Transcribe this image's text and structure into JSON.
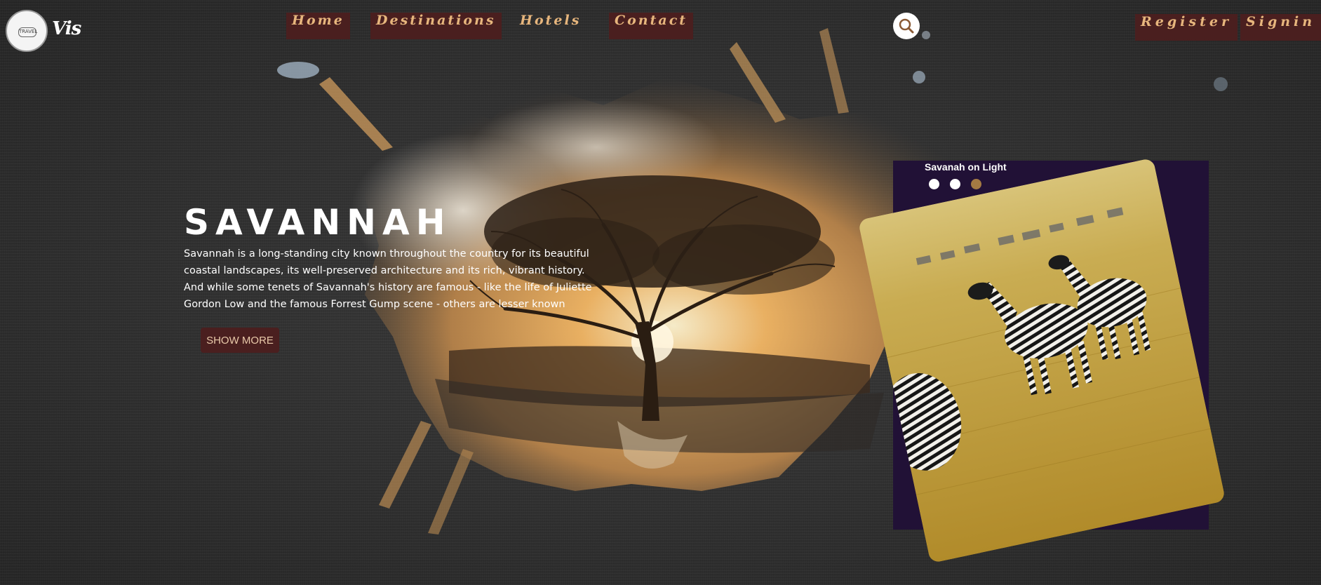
{
  "brand": {
    "logo_badge": "TRAVEL",
    "logo_text": "Vis"
  },
  "nav": {
    "home": "Home",
    "destinations": "Destinations",
    "hotels": "Hotels",
    "contact": "Contact",
    "register": "Register",
    "signin": "Signin",
    "search_icon": "search-icon"
  },
  "hero": {
    "title": "SAVANNAH",
    "description": "Savannah is a long-standing city known throughout the country for its beautiful coastal landscapes, its well-preserved architecture and its rich, vibrant history. And while some tenets of Savannah's history are famous - like the life of Juliette Gordon Low and the famous Forrest Gump scene - others are lesser known",
    "show_more": "SHOW MORE"
  },
  "card": {
    "title": "Savanah on Light",
    "dots": [
      false,
      false,
      true
    ]
  },
  "colors": {
    "button_bg": "#4a1f1f",
    "nav_text": "#e7b67d",
    "card_bg": "#211136",
    "active_dot": "#a47a43"
  }
}
